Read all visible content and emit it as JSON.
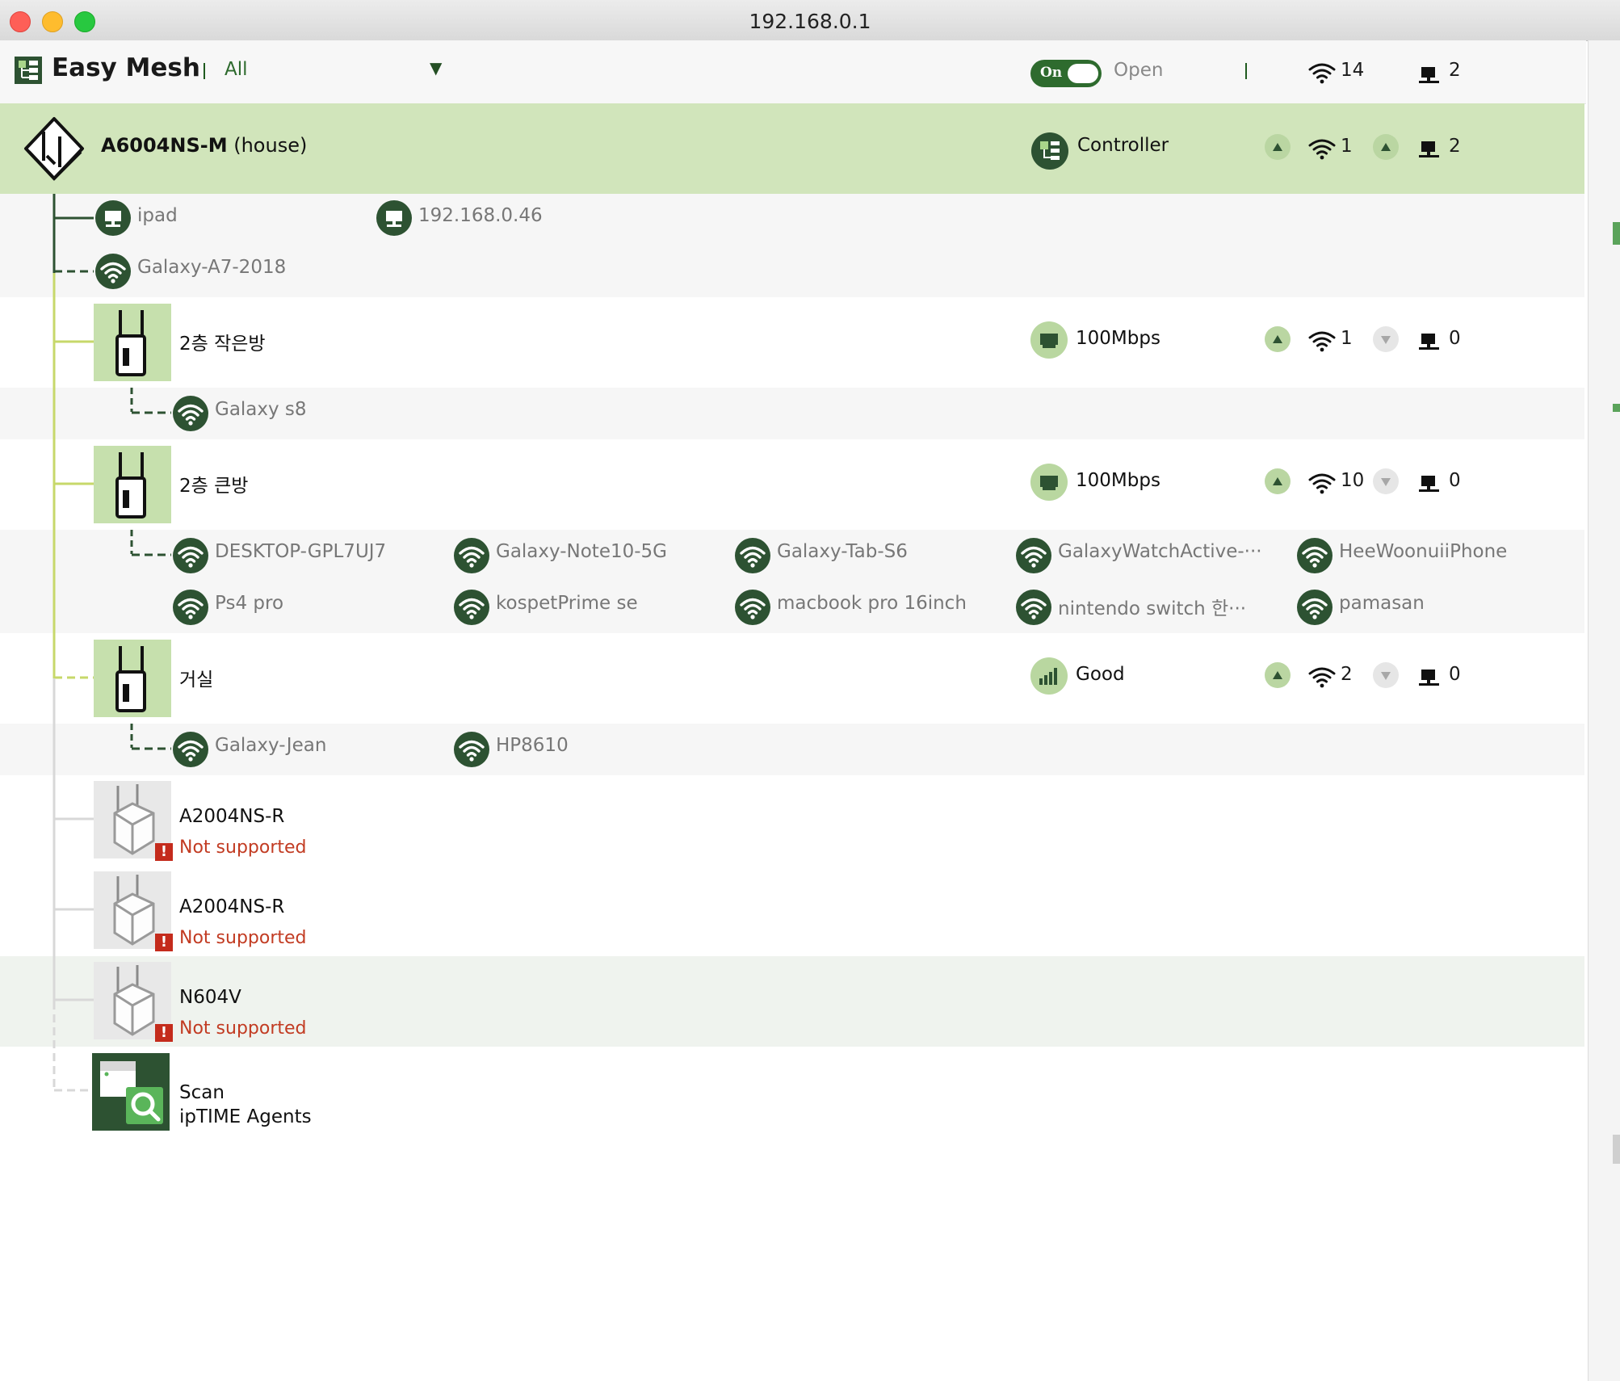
{
  "window": {
    "title": "192.168.0.1"
  },
  "toolbar": {
    "app_name": "Easy Mesh",
    "filter_label": "All",
    "toggle_label": "On",
    "toggle_state": "on",
    "status_label": "Open",
    "wifi_total": "14",
    "wired_total": "2"
  },
  "controller": {
    "model": "A6004NS-M",
    "alias": "(house)",
    "role": "Controller",
    "wifi_count": "1",
    "wired_count": "2",
    "clients": [
      {
        "name": "ipad",
        "type": "wired"
      },
      {
        "name": "192.168.0.46",
        "type": "wired"
      },
      {
        "name": "Galaxy-A7-2018",
        "type": "wifi"
      }
    ]
  },
  "agents": [
    {
      "name": "2층 작은방",
      "link_label": "100Mbps",
      "link_type": "wired",
      "wifi_count": "1",
      "wired_count": "0",
      "clients": [
        "Galaxy s8"
      ]
    },
    {
      "name": "2층 큰방",
      "link_label": "100Mbps",
      "link_type": "wired",
      "wifi_count": "10",
      "wired_count": "0",
      "clients": [
        "DESKTOP-GPL7UJ7",
        "Galaxy-Note10-5G",
        "Galaxy-Tab-S6",
        "GalaxyWatchActive-···",
        "HeeWoonuiiPhone",
        "Ps4 pro",
        "kospetPrime se",
        "macbook pro 16inch",
        "nintendo switch 한···",
        "pamasan"
      ]
    },
    {
      "name": "거실",
      "link_label": "Good",
      "link_type": "signal",
      "wifi_count": "2",
      "wired_count": "0",
      "clients": [
        "Galaxy-Jean",
        "HP8610"
      ]
    }
  ],
  "unsupported": [
    {
      "name": "A2004NS-R",
      "status": "Not supported"
    },
    {
      "name": "A2004NS-R",
      "status": "Not supported"
    },
    {
      "name": "N604V",
      "status": "Not supported"
    }
  ],
  "scan": {
    "line1": "Scan",
    "line2": "ipTIME Agents"
  },
  "colors": {
    "accent": "#2d5232",
    "controller_bg": "#d1e5bb",
    "tile_bg": "#c6e0ad",
    "error": "#c23b22",
    "toggle_on": "#2e6b2e"
  }
}
